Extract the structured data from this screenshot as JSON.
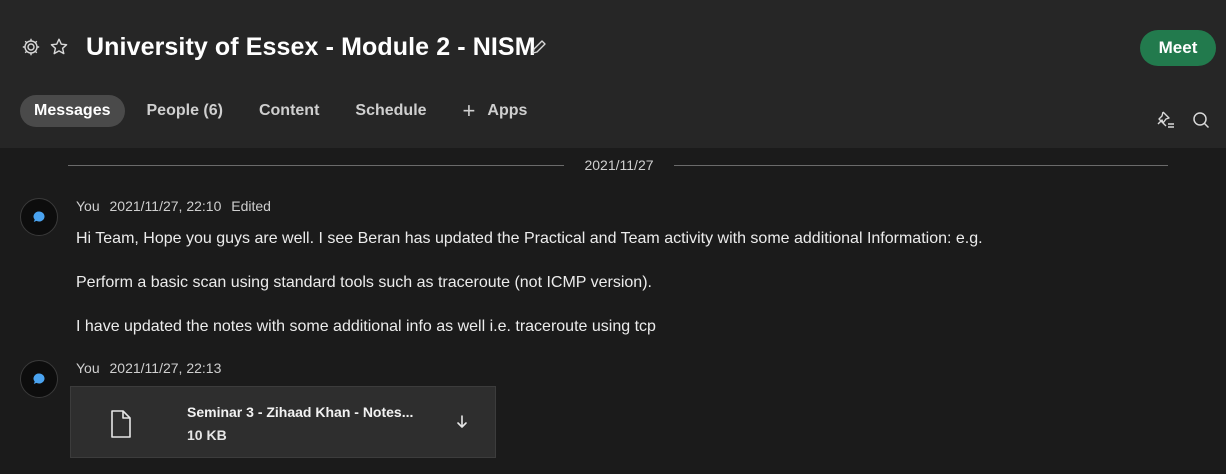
{
  "header": {
    "title": "University of Essex - Module 2 - NISM",
    "meet_label": "Meet",
    "tabs": [
      {
        "label": "Messages",
        "active": true
      },
      {
        "label": "People (6)",
        "active": false
      },
      {
        "label": "Content",
        "active": false
      },
      {
        "label": "Schedule",
        "active": false
      },
      {
        "label": "Apps",
        "active": false,
        "prefix": "+"
      }
    ],
    "icons": [
      "gear-icon",
      "star-icon",
      "pencil-icon",
      "pin-list-icon",
      "search-icon"
    ]
  },
  "date_separator": "2021/11/27",
  "messages": [
    {
      "author": "You",
      "timestamp": "2021/11/27, 22:10",
      "status": "Edited",
      "lines": [
        "Hi Team, Hope you guys are well. I see Beran has updated the Practical and Team activity with some additional Information: e.g.",
        "Perform a basic scan using standard tools such as traceroute (not ICMP version).",
        "I have updated the notes with some additional info as well i.e. traceroute using tcp"
      ]
    },
    {
      "author": "You",
      "timestamp": "2021/11/27, 22:13",
      "attachment": {
        "name": "Seminar 3 - Zihaad Khan - Notes...",
        "size": "10 KB"
      }
    }
  ],
  "colors": {
    "background": "#1b1b1b",
    "header": "#262626",
    "meet_button": "#227a4d",
    "active_tab": "#4a4a4a",
    "avatar_accent": "#4aa3f0"
  }
}
